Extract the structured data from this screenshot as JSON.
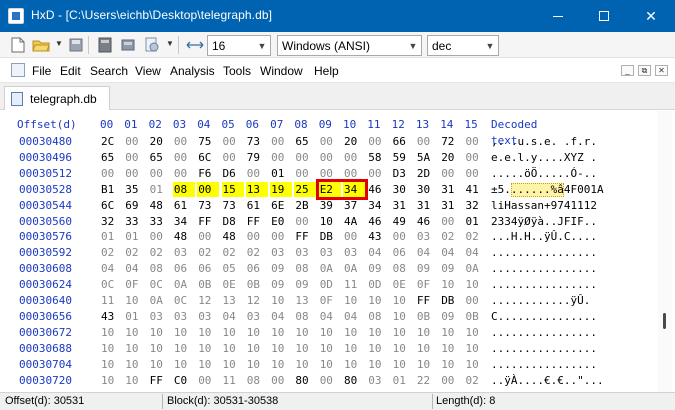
{
  "window": {
    "title": "HxD - [C:\\Users\\eichb\\Desktop\\telegraph.db]",
    "minimize": "—",
    "maximize": "□",
    "close": "✕"
  },
  "toolbar": {
    "bytes_per_row": "16",
    "charset": "Windows (ANSI)",
    "offset_base": "dec",
    "icons": [
      "new-file-icon",
      "open-folder-icon",
      "save-icon",
      "disk-icon",
      "ram-icon",
      "open-disk-image-icon",
      "columns-icon"
    ]
  },
  "menu": {
    "items": [
      "File",
      "Edit",
      "Search",
      "View",
      "Analysis",
      "Tools",
      "Window",
      "Help"
    ],
    "mdi_minimize": "_",
    "mdi_restore": "⧉",
    "mdi_close": "✕"
  },
  "tab": {
    "label": "telegraph.db"
  },
  "hex": {
    "header_offset": "Offset(d)",
    "columns": [
      "00",
      "01",
      "02",
      "03",
      "04",
      "05",
      "06",
      "07",
      "08",
      "09",
      "10",
      "11",
      "12",
      "13",
      "14",
      "15"
    ],
    "header_decoded": "Decoded text",
    "rows": [
      {
        "offset": "00030480",
        "bytes": [
          "2C",
          "00",
          "20",
          "00",
          "75",
          "00",
          "73",
          "00",
          "65",
          "00",
          "20",
          "00",
          "66",
          "00",
          "72",
          "00"
        ],
        "decoded": ",. .u.s.e. .f.r."
      },
      {
        "offset": "00030496",
        "bytes": [
          "65",
          "00",
          "65",
          "00",
          "6C",
          "00",
          "79",
          "00",
          "00",
          "00",
          "00",
          "58",
          "59",
          "5A",
          "20",
          "00"
        ],
        "decoded": "e.e.l.y....XYZ ."
      },
      {
        "offset": "00030512",
        "bytes": [
          "00",
          "00",
          "00",
          "00",
          "F6",
          "D6",
          "00",
          "01",
          "00",
          "00",
          "00",
          "00",
          "D3",
          "2D",
          "00",
          "00"
        ],
        "decoded": ".....öÖ.....Ó-.."
      },
      {
        "offset": "00030528",
        "bytes": [
          "B1",
          "35",
          "01",
          "08",
          "00",
          "15",
          "13",
          "19",
          "25",
          "E2",
          "34",
          "46",
          "30",
          "30",
          "31",
          "41"
        ],
        "decoded": "±5.......%â4F001A"
      },
      {
        "offset": "00030544",
        "bytes": [
          "6C",
          "69",
          "48",
          "61",
          "73",
          "73",
          "61",
          "6E",
          "2B",
          "39",
          "37",
          "34",
          "31",
          "31",
          "31",
          "32"
        ],
        "decoded": "liHassan+9741112"
      },
      {
        "offset": "00030560",
        "bytes": [
          "32",
          "33",
          "33",
          "34",
          "FF",
          "D8",
          "FF",
          "E0",
          "00",
          "10",
          "4A",
          "46",
          "49",
          "46",
          "00",
          "01"
        ],
        "decoded": "2334ÿØÿà..JFIF.."
      },
      {
        "offset": "00030576",
        "bytes": [
          "01",
          "01",
          "00",
          "48",
          "00",
          "48",
          "00",
          "00",
          "FF",
          "DB",
          "00",
          "43",
          "00",
          "03",
          "02",
          "02"
        ],
        "decoded": "...H.H..ÿÛ.C...."
      },
      {
        "offset": "00030592",
        "bytes": [
          "02",
          "02",
          "02",
          "03",
          "02",
          "02",
          "02",
          "03",
          "03",
          "03",
          "03",
          "04",
          "06",
          "04",
          "04",
          "04"
        ],
        "decoded": "................"
      },
      {
        "offset": "00030608",
        "bytes": [
          "04",
          "04",
          "08",
          "06",
          "06",
          "05",
          "06",
          "09",
          "08",
          "0A",
          "0A",
          "09",
          "08",
          "09",
          "09",
          "0A"
        ],
        "decoded": "................"
      },
      {
        "offset": "00030624",
        "bytes": [
          "0C",
          "0F",
          "0C",
          "0A",
          "0B",
          "0E",
          "0B",
          "09",
          "09",
          "0D",
          "11",
          "0D",
          "0E",
          "0F",
          "10",
          "10"
        ],
        "decoded": "................"
      },
      {
        "offset": "00030640",
        "bytes": [
          "11",
          "10",
          "0A",
          "0C",
          "12",
          "13",
          "12",
          "10",
          "13",
          "0F",
          "10",
          "10",
          "10",
          "FF",
          "DB",
          "00"
        ],
        "decoded": "............ÿÛ."
      },
      {
        "offset": "00030656",
        "bytes": [
          "43",
          "01",
          "03",
          "03",
          "03",
          "04",
          "03",
          "04",
          "08",
          "04",
          "04",
          "08",
          "10",
          "0B",
          "09",
          "0B"
        ],
        "decoded": "C..............."
      },
      {
        "offset": "00030672",
        "bytes": [
          "10",
          "10",
          "10",
          "10",
          "10",
          "10",
          "10",
          "10",
          "10",
          "10",
          "10",
          "10",
          "10",
          "10",
          "10",
          "10"
        ],
        "decoded": "................"
      },
      {
        "offset": "00030688",
        "bytes": [
          "10",
          "10",
          "10",
          "10",
          "10",
          "10",
          "10",
          "10",
          "10",
          "10",
          "10",
          "10",
          "10",
          "10",
          "10",
          "10"
        ],
        "decoded": "................"
      },
      {
        "offset": "00030704",
        "bytes": [
          "10",
          "10",
          "10",
          "10",
          "10",
          "10",
          "10",
          "10",
          "10",
          "10",
          "10",
          "10",
          "10",
          "10",
          "10",
          "10"
        ],
        "decoded": "................"
      },
      {
        "offset": "00030720",
        "bytes": [
          "10",
          "10",
          "FF",
          "C0",
          "00",
          "11",
          "08",
          "00",
          "80",
          "00",
          "80",
          "03",
          "01",
          "22",
          "00",
          "02"
        ],
        "decoded": "..ÿÀ....€.€..\"..."
      }
    ]
  },
  "status": {
    "offset": "Offset(d): 30531",
    "block": "Block(d): 30531-30538",
    "length": "Length(d): 8"
  },
  "colors": {
    "titlebar": "#0063b1",
    "offset_blue": "#1b39c2",
    "selection": "#ffff00",
    "highlight_box": "#e00000"
  }
}
